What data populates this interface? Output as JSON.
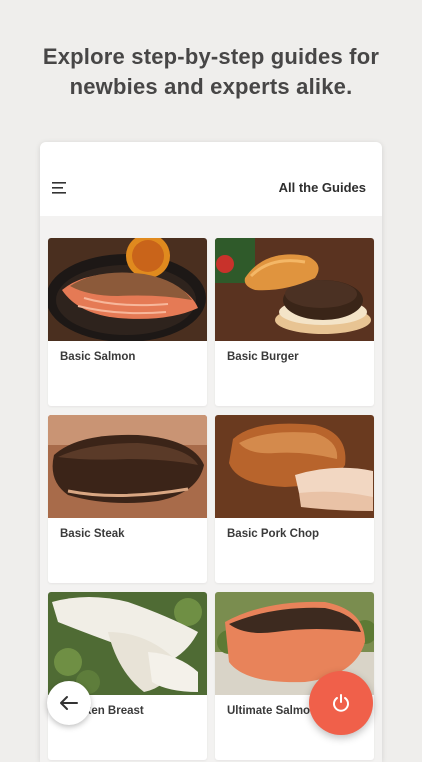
{
  "headline": {
    "line1": "Explore step-by-step guides for",
    "line2": "newbies and experts alike."
  },
  "app_bar": {
    "title": "All the Guides",
    "menu_icon": "hamburger-menu-icon"
  },
  "guides": [
    {
      "label": "Basic Salmon"
    },
    {
      "label": "Basic Burger"
    },
    {
      "label": "Basic Steak"
    },
    {
      "label": "Basic Pork Chop"
    },
    {
      "label": "Chicken Breast"
    },
    {
      "label": "Ultimate Salmon"
    }
  ],
  "buttons": {
    "back_icon": "arrow-left-icon",
    "power_icon": "power-icon"
  },
  "colors": {
    "accent": "#f0604a",
    "background": "#efeeec",
    "text": "#474646"
  }
}
